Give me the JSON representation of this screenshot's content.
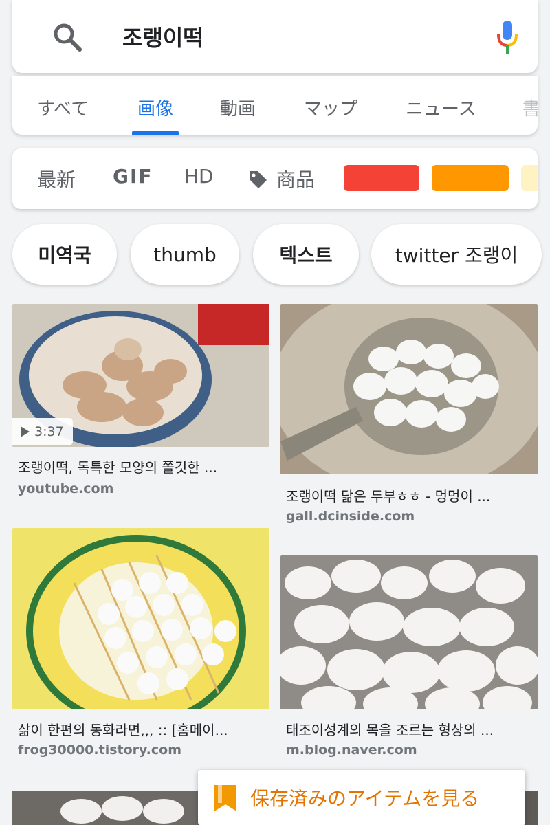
{
  "search": {
    "query": "조랭이떡"
  },
  "tabs": [
    {
      "label": "すべて"
    },
    {
      "label": "画像"
    },
    {
      "label": "動画"
    },
    {
      "label": "マップ"
    },
    {
      "label": "ニュース"
    },
    {
      "label": "書"
    }
  ],
  "filters": {
    "latest": "最新",
    "gif": "GIF",
    "hd": "HD",
    "products": "商品",
    "color_swatches": [
      "#f44336",
      "#ff9800",
      "#fff3c4"
    ]
  },
  "chips": [
    {
      "label": "미역국"
    },
    {
      "label": "thumb"
    },
    {
      "label": "텍스트"
    },
    {
      "label": "twitter 조랭이"
    }
  ],
  "results": [
    {
      "title": "조랭이떡, 독특한 모양의 쫄깃한 ...",
      "source": "youtube.com",
      "duration": "3:37"
    },
    {
      "title": "조랭이떡 닮은 두부ㅎㅎ - 멍멍이 ...",
      "source": "gall.dcinside.com"
    },
    {
      "title": "삶이 한편의 동화라면,,, :: [홈메이...",
      "source": "frog30000.tistory.com"
    },
    {
      "title": "태조이성계의 목을 조르는 형상의 ...",
      "source": "m.blog.naver.com"
    }
  ],
  "saved_bar": {
    "label": "保存済みのアイテムを見る"
  },
  "colors": {
    "accent": "#1a73e8",
    "saved": "#e37400"
  },
  "icons": [
    "search-icon",
    "mic-icon",
    "tag-icon",
    "play-icon",
    "bookmark-icon"
  ]
}
